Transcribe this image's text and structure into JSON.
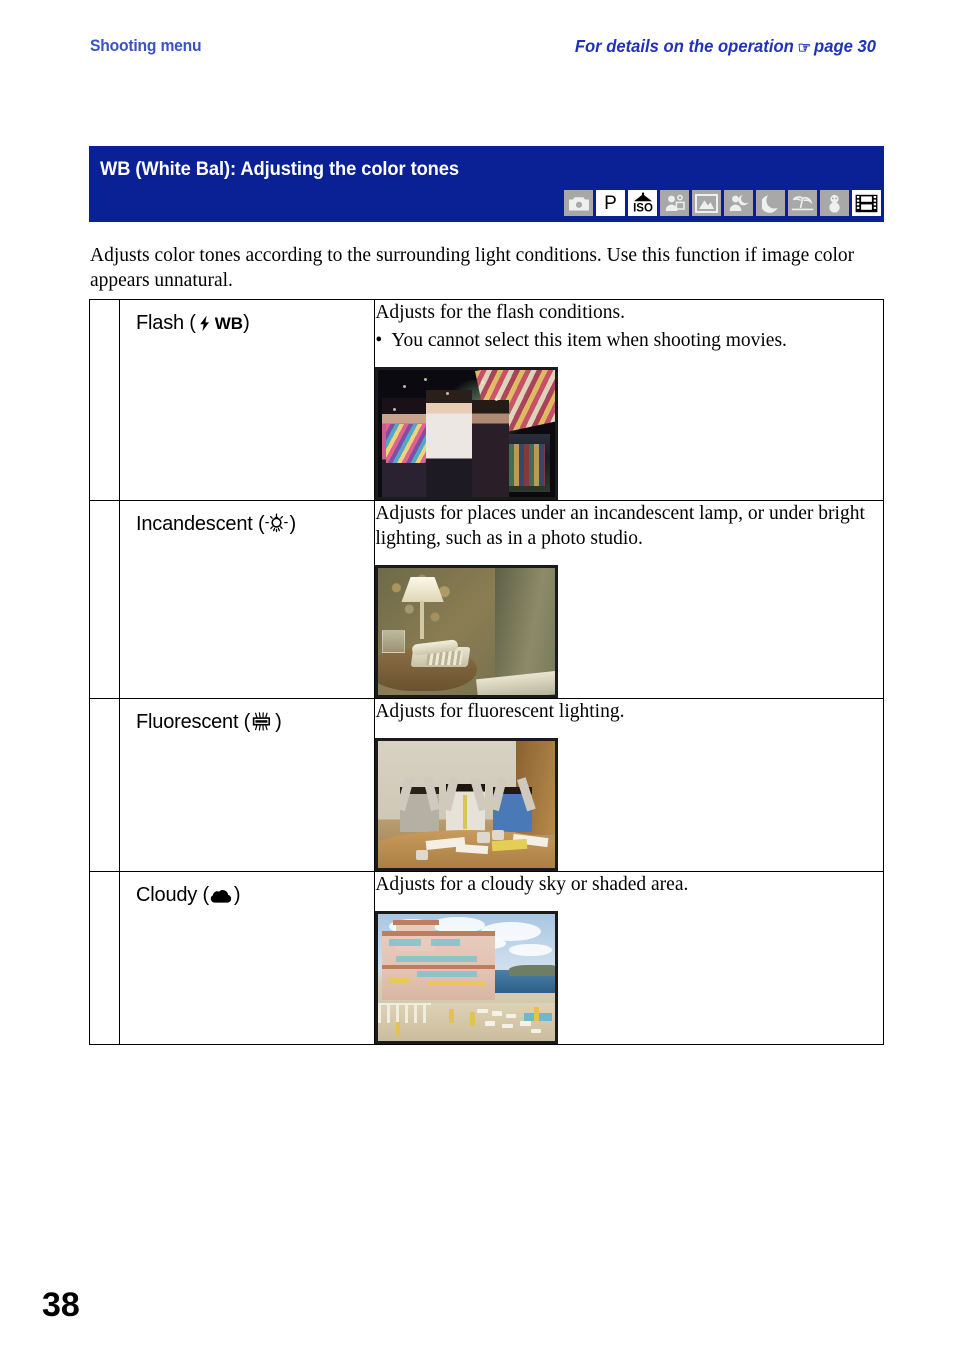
{
  "running_head": {
    "left": "Shooting menu",
    "right_prefix": "For details on the operation",
    "hand_icon": "☞",
    "right_suffix": "page 30",
    "color": "#2033b8"
  },
  "section": {
    "title": "WB (White Bal): Adjusting the color tones",
    "bar_color": "#0a2196",
    "mode_icons": [
      {
        "name": "still-camera-icon",
        "label": "Camera",
        "active": false
      },
      {
        "name": "program-auto-icon",
        "label": "P",
        "active": true
      },
      {
        "name": "iso-high-sensitivity-icon",
        "label": "ISO",
        "active": true
      },
      {
        "name": "soft-snap-icon",
        "label": "Soft Snap",
        "active": false
      },
      {
        "name": "landscape-icon",
        "label": "Landscape",
        "active": false
      },
      {
        "name": "twilight-portrait-icon",
        "label": "Twilight Portrait",
        "active": false
      },
      {
        "name": "twilight-icon",
        "label": "Twilight",
        "active": false
      },
      {
        "name": "beach-icon",
        "label": "Beach",
        "active": false
      },
      {
        "name": "snow-icon",
        "label": "Snow",
        "active": false
      },
      {
        "name": "movie-mode-icon",
        "label": "Movie",
        "active": true
      }
    ]
  },
  "intro": "Adjusts color tones according to the surrounding light conditions. Use this function if image color appears unnatural.",
  "table": {
    "rows": [
      {
        "name_prefix": "Flash (",
        "symbol": "WB",
        "symbol_icon": "flash-wb-icon",
        "name_suffix": ")",
        "description": "Adjusts for the flash conditions.",
        "bullet": "You cannot select this item when shooting movies.",
        "photo_name": "flash-sample-photo",
        "photo_alt": "Three people at night lit by flash"
      },
      {
        "name_prefix": "Incandescent (",
        "symbol": "",
        "symbol_icon": "incandescent-lamp-icon",
        "name_suffix": ")",
        "description": "Adjusts for places under an incandescent lamp, or under bright lighting, such as in a photo studio.",
        "bullet": "",
        "photo_name": "incandescent-sample-photo",
        "photo_alt": "Bedside lamp and telephone in warm light"
      },
      {
        "name_prefix": "Fluorescent (",
        "symbol": "",
        "symbol_icon": "fluorescent-tube-icon",
        "name_suffix": ")",
        "description": "Adjusts for fluorescent lighting.",
        "bullet": "",
        "photo_name": "fluorescent-sample-photo",
        "photo_alt": "Three men celebrating at an office table"
      },
      {
        "name_prefix": "Cloudy (",
        "symbol": "",
        "symbol_icon": "cloud-icon",
        "name_suffix": ")",
        "description": "Adjusts for a cloudy sky or shaded area.",
        "bullet": "",
        "photo_name": "cloudy-sample-photo",
        "photo_alt": "Seaside hotel under a cloudy sky"
      }
    ]
  },
  "folio": "38"
}
